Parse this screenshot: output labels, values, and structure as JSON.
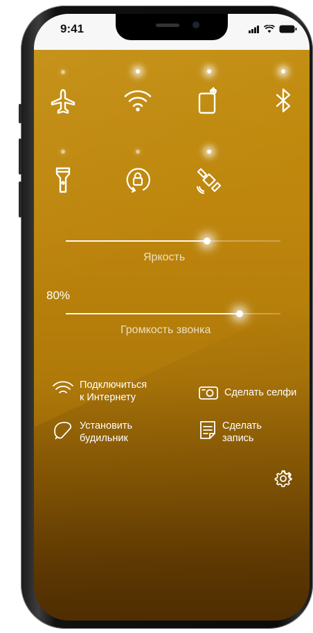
{
  "status_bar": {
    "time": "9:41"
  },
  "toggles": [
    {
      "name": "airplane-mode",
      "active": false
    },
    {
      "name": "wifi",
      "active": true
    },
    {
      "name": "screen-lock",
      "active": true
    },
    {
      "name": "bluetooth",
      "active": true
    },
    {
      "name": "flashlight",
      "active": false
    },
    {
      "name": "rotation-lock",
      "active": false
    },
    {
      "name": "satellite",
      "active": true
    }
  ],
  "brightness": {
    "label": "Яркость",
    "level": 0.66
  },
  "volume": {
    "label": "Громкость звонка",
    "percent_text": "80%",
    "level": 0.8
  },
  "shortcuts": {
    "connect": {
      "line1": "Подключиться",
      "line2": "к Интернету"
    },
    "selfie": {
      "label": "Сделать селфи"
    },
    "alarm": {
      "line1": "Установить",
      "line2": "будильник"
    },
    "note": {
      "line1": "Сделать",
      "line2": "запись"
    }
  },
  "colors": {
    "accent_bg": "#c38e0f",
    "glow": "#ffffff"
  }
}
